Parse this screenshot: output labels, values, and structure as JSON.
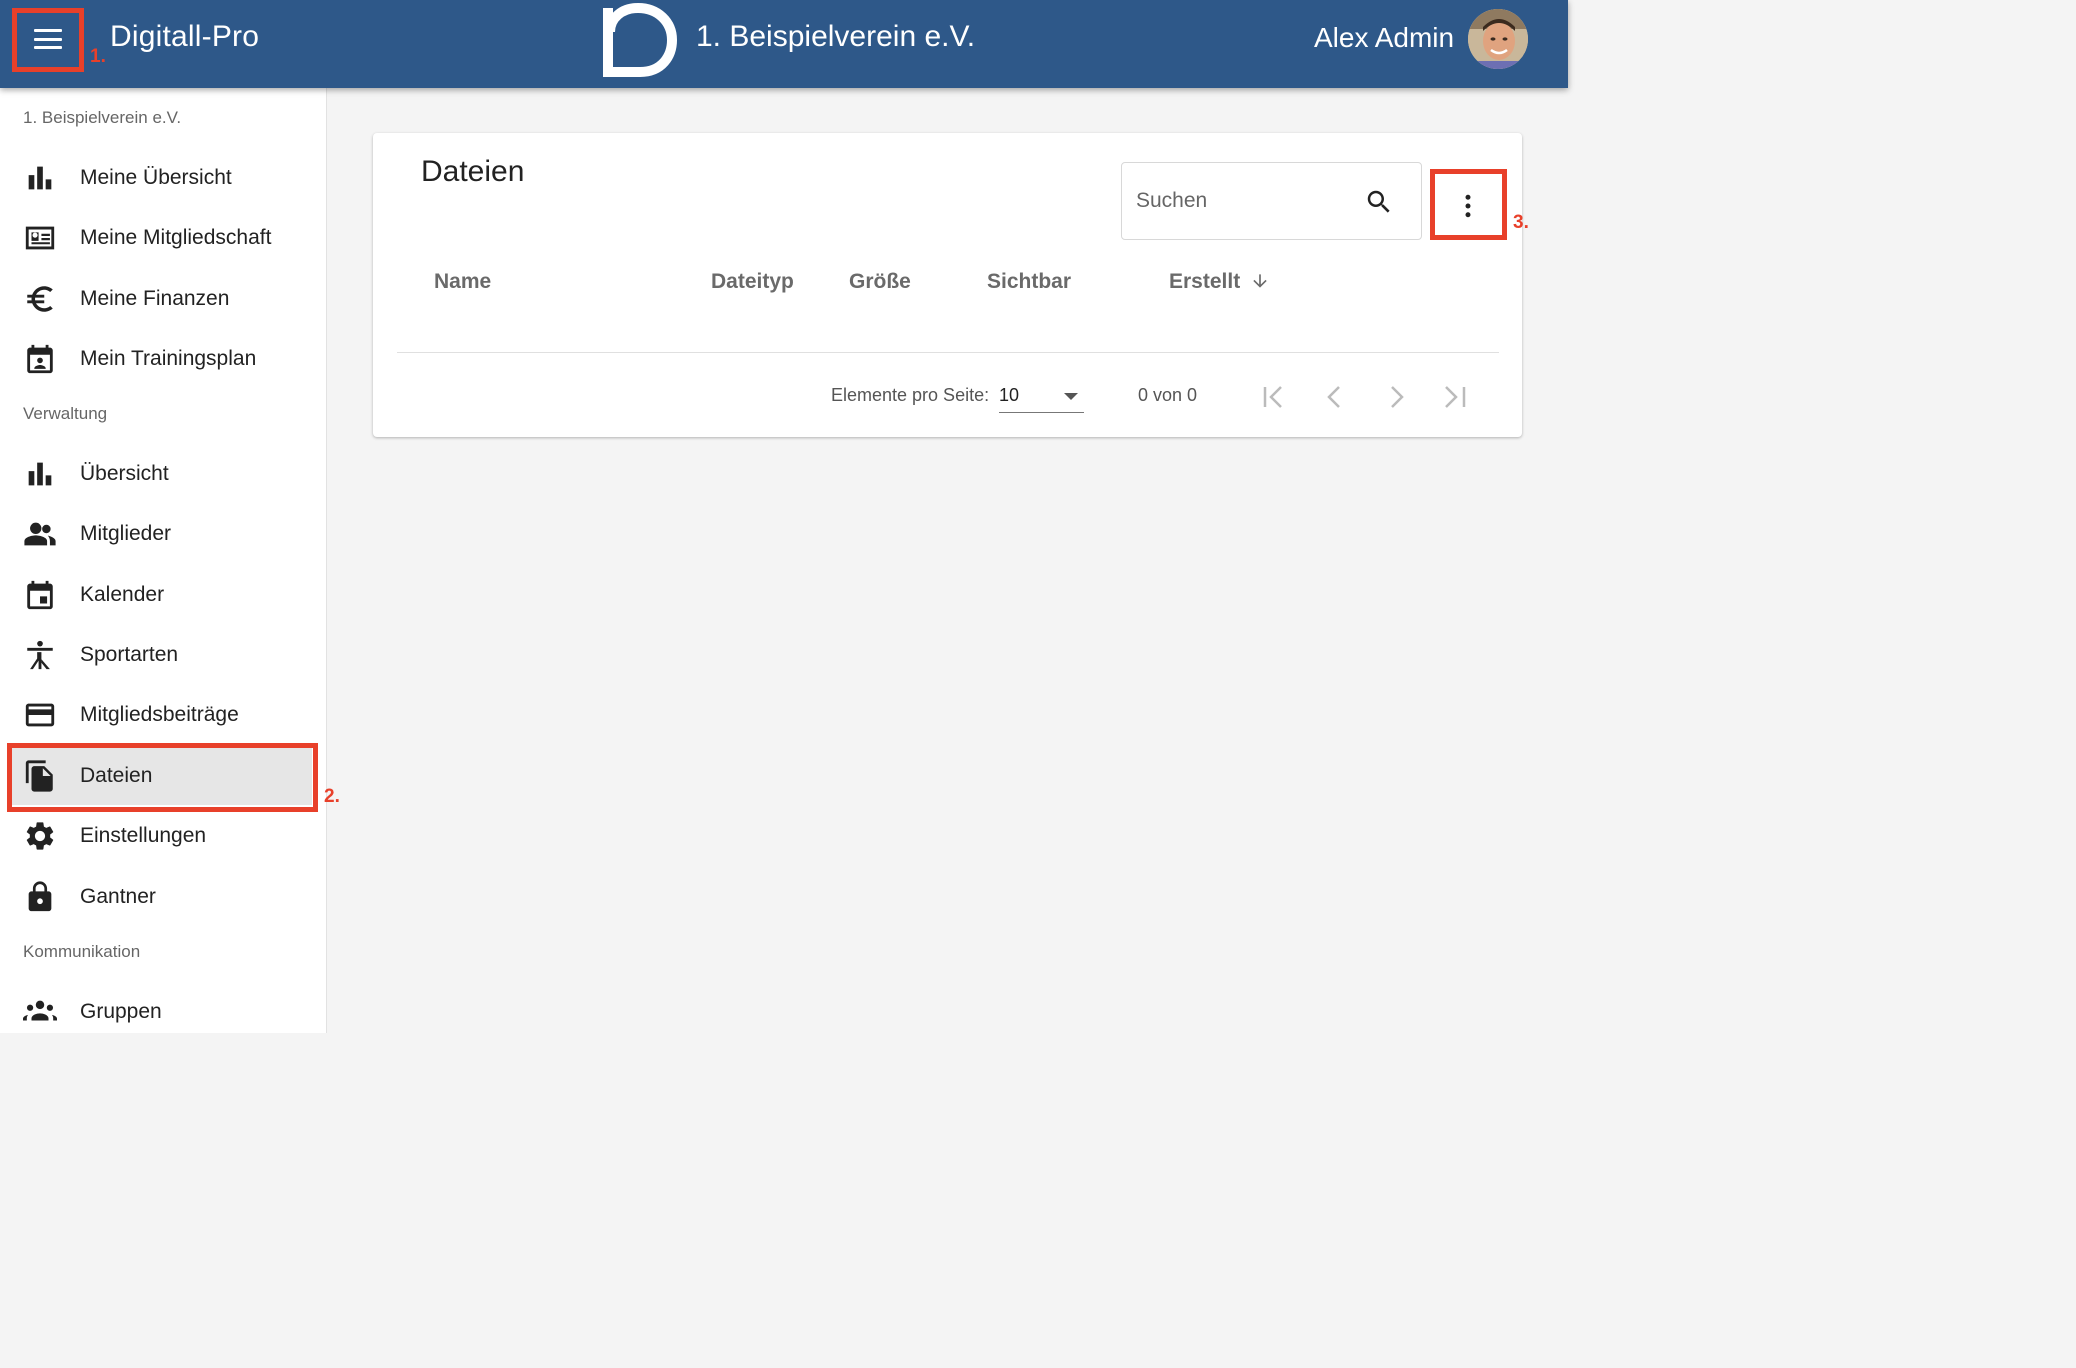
{
  "header": {
    "menu_icon": "hamburger-menu-icon",
    "app_title": "Digitall-Pro",
    "club_title": "1. Beispielverein e.V.",
    "user_name": "Alex Admin",
    "bg_color": "#2e5889"
  },
  "annotations": [
    {
      "label": "1."
    },
    {
      "label": "2."
    },
    {
      "label": "3."
    }
  ],
  "sidebar": {
    "sections": [
      {
        "title": "1. Beispielverein e.V.",
        "items": [
          {
            "label": "Meine Übersicht",
            "icon": "bar-chart-icon"
          },
          {
            "label": "Meine Mitgliedschaft",
            "icon": "id-card-icon"
          },
          {
            "label": "Meine Finanzen",
            "icon": "euro-icon"
          },
          {
            "label": "Mein Trainingsplan",
            "icon": "calendar-person-icon"
          }
        ]
      },
      {
        "title": "Verwaltung",
        "items": [
          {
            "label": "Übersicht",
            "icon": "bar-chart-icon"
          },
          {
            "label": "Mitglieder",
            "icon": "people-icon"
          },
          {
            "label": "Kalender",
            "icon": "calendar-icon"
          },
          {
            "label": "Sportarten",
            "icon": "sport-figure-icon"
          },
          {
            "label": "Mitgliedsbeiträge",
            "icon": "credit-card-icon"
          },
          {
            "label": "Dateien",
            "icon": "files-icon",
            "active": true
          },
          {
            "label": "Einstellungen",
            "icon": "gear-icon"
          },
          {
            "label": "Gantner",
            "icon": "lock-icon"
          }
        ]
      },
      {
        "title": "Kommunikation",
        "items": [
          {
            "label": "Gruppen",
            "icon": "groups-icon"
          }
        ]
      }
    ]
  },
  "main": {
    "title": "Dateien",
    "search": {
      "placeholder": "Suchen",
      "value": ""
    },
    "table": {
      "columns": [
        "Name",
        "Dateityp",
        "Größe",
        "Sichtbar",
        "Erstellt"
      ],
      "sort_column": "Erstellt",
      "sort_direction": "descending",
      "rows": []
    },
    "pagination": {
      "items_per_page_label": "Elemente pro Seite:",
      "items_per_page": "10",
      "range": "0 von 0"
    }
  }
}
